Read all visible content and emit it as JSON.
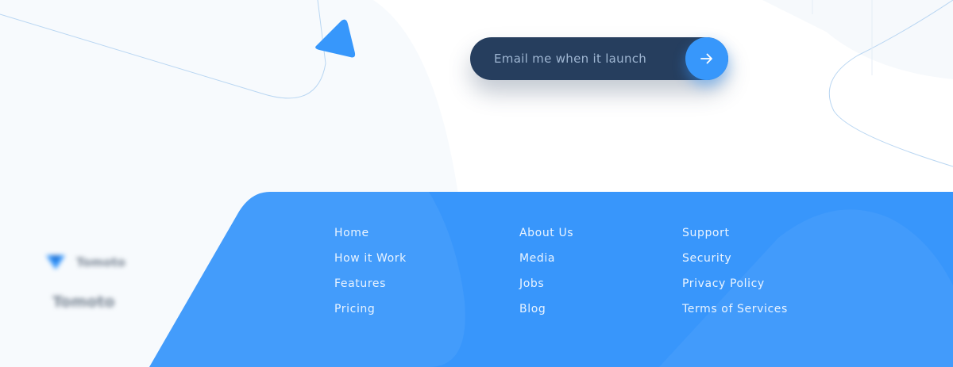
{
  "email_cta": {
    "placeholder": "Email me when it launch",
    "submit_icon": "arrow-right-icon"
  },
  "brand": {
    "logo_icon": "brand-logo-icon",
    "name": "Tomoto",
    "tagline": "Tomoto"
  },
  "footer": {
    "columns": [
      {
        "links": [
          "Home",
          "How it Work",
          "Features",
          "Pricing"
        ]
      },
      {
        "links": [
          "About Us",
          "Media",
          "Jobs",
          "Blog"
        ]
      },
      {
        "links": [
          "Support",
          "Security",
          "Privacy Policy",
          "Terms of Services"
        ]
      }
    ]
  },
  "colors": {
    "accent_blue": "#3797fb",
    "pill_navy": "#263e5e",
    "footer_text": "#eaf4ff",
    "decor_triangle": "#3797fb"
  }
}
